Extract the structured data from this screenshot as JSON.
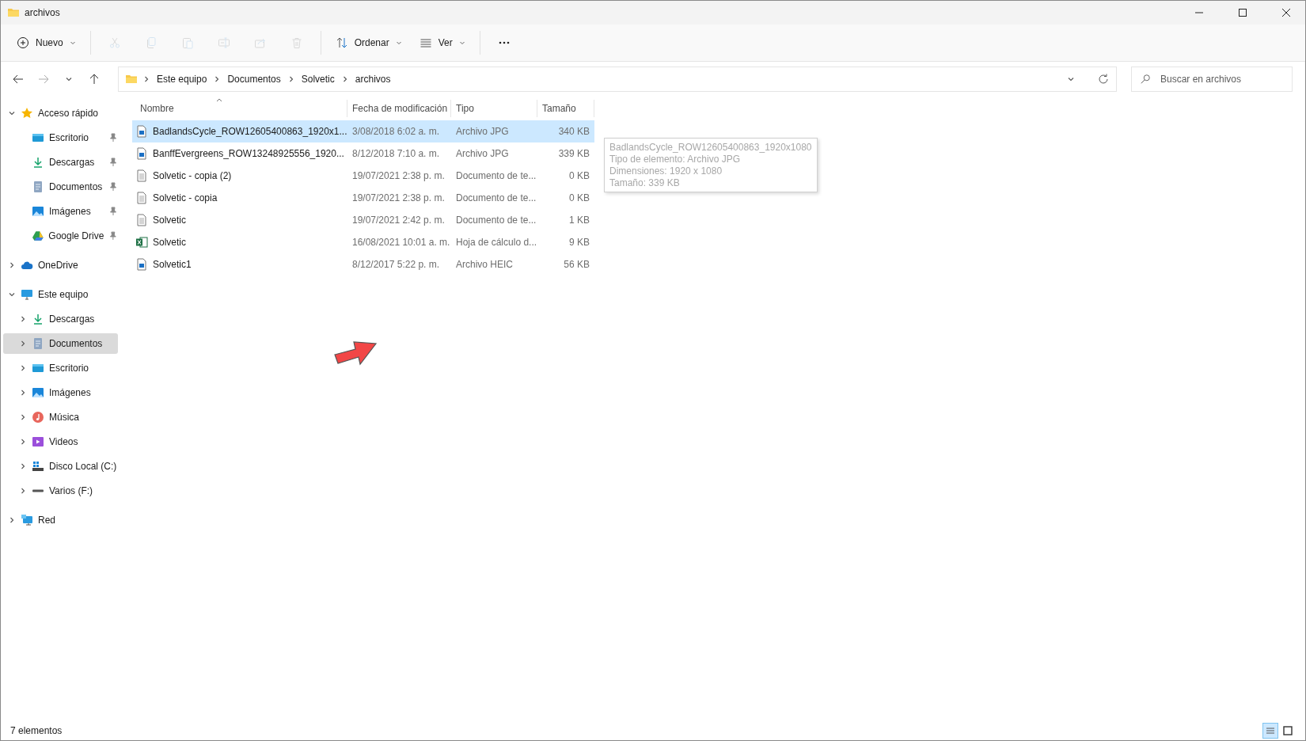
{
  "window": {
    "title": "archivos"
  },
  "toolbar": {
    "items": [
      {
        "kind": "new",
        "label": "Nuevo",
        "disabled": false
      },
      {
        "kind": "cut",
        "disabled": true
      },
      {
        "kind": "copy",
        "disabled": true
      },
      {
        "kind": "paste",
        "disabled": true
      },
      {
        "kind": "rename",
        "disabled": true
      },
      {
        "kind": "share",
        "disabled": true
      },
      {
        "kind": "delete",
        "disabled": true
      },
      {
        "kind": "sort",
        "label": "Ordenar",
        "disabled": false
      },
      {
        "kind": "view",
        "label": "Ver",
        "disabled": false
      },
      {
        "kind": "more",
        "disabled": false
      }
    ]
  },
  "address": {
    "crumbs": [
      "Este equipo",
      "Documentos",
      "Solvetic",
      "archivos"
    ]
  },
  "search": {
    "placeholder": "Buscar en archivos"
  },
  "sidebar": {
    "items": [
      {
        "label": "Acceso rápido",
        "kind": "star",
        "expanded": true,
        "selected": false,
        "children": [
          {
            "label": "Escritorio",
            "kind": "desktop",
            "pinned": true,
            "selected": false
          },
          {
            "label": "Descargas",
            "kind": "download",
            "pinned": true,
            "selected": false
          },
          {
            "label": "Documentos",
            "kind": "documents",
            "pinned": true,
            "selected": false
          },
          {
            "label": "Imágenes",
            "kind": "pictures",
            "pinned": true,
            "selected": false
          },
          {
            "label": "Google Drive",
            "kind": "gdrive",
            "pinned": true,
            "selected": false
          }
        ]
      },
      {
        "label": "OneDrive",
        "kind": "cloud",
        "expanded": false,
        "selected": false
      },
      {
        "label": "Este equipo",
        "kind": "pc",
        "expanded": true,
        "selected": false,
        "children": [
          {
            "label": "Descargas",
            "kind": "download",
            "expanded": false,
            "selected": false
          },
          {
            "label": "Documentos",
            "kind": "documents",
            "expanded": false,
            "selected": true
          },
          {
            "label": "Escritorio",
            "kind": "desktop",
            "expanded": false,
            "selected": false
          },
          {
            "label": "Imágenes",
            "kind": "pictures",
            "expanded": false,
            "selected": false
          },
          {
            "label": "Música",
            "kind": "music",
            "expanded": false,
            "selected": false
          },
          {
            "label": "Videos",
            "kind": "video",
            "expanded": false,
            "selected": false
          },
          {
            "label": "Disco Local (C:)",
            "kind": "disk",
            "expanded": false,
            "selected": false
          },
          {
            "label": "Varios (F:)",
            "kind": "drive",
            "expanded": false,
            "selected": false
          }
        ]
      },
      {
        "label": "Red",
        "kind": "network",
        "expanded": false,
        "selected": false
      }
    ]
  },
  "table": {
    "columns": [
      "Nombre",
      "Fecha de modificación",
      "Tipo",
      "Tamaño"
    ],
    "rows": [
      {
        "kind": "image",
        "name": "BadlandsCycle_ROW12605400863_1920x1...",
        "date": "3/08/2018 6:02 a. m.",
        "type": "Archivo JPG",
        "size": "340 KB",
        "selected": true
      },
      {
        "kind": "image",
        "name": "BanffEvergreens_ROW13248925556_1920...",
        "date": "8/12/2018 7:10 a. m.",
        "type": "Archivo JPG",
        "size": "339 KB",
        "selected": false
      },
      {
        "kind": "text",
        "name": "Solvetic - copia (2)",
        "date": "19/07/2021 2:38 p. m.",
        "type": "Documento de te...",
        "size": "0 KB",
        "selected": false
      },
      {
        "kind": "text",
        "name": "Solvetic - copia",
        "date": "19/07/2021 2:38 p. m.",
        "type": "Documento de te...",
        "size": "0 KB",
        "selected": false
      },
      {
        "kind": "text",
        "name": "Solvetic",
        "date": "19/07/2021 2:42 p. m.",
        "type": "Documento de te...",
        "size": "1 KB",
        "selected": false
      },
      {
        "kind": "excel",
        "name": "Solvetic",
        "date": "16/08/2021 10:01 a. m.",
        "type": "Hoja de cálculo d...",
        "size": "9 KB",
        "selected": false
      },
      {
        "kind": "image",
        "name": "Solvetic1",
        "date": "8/12/2017 5:22 p. m.",
        "type": "Archivo HEIC",
        "size": "56 KB",
        "selected": false
      }
    ]
  },
  "tooltip": {
    "lines": [
      "BadlandsCycle_ROW12605400863_1920x1080",
      "Tipo de elemento: Archivo JPG",
      "Dimensiones: 1920 x 1080",
      "Tamaño: 339 KB"
    ]
  },
  "status_bar": {
    "count": "7 elementos",
    "views": [
      {
        "kind": "details",
        "selected": true
      },
      {
        "kind": "tiles",
        "selected": false
      }
    ]
  }
}
